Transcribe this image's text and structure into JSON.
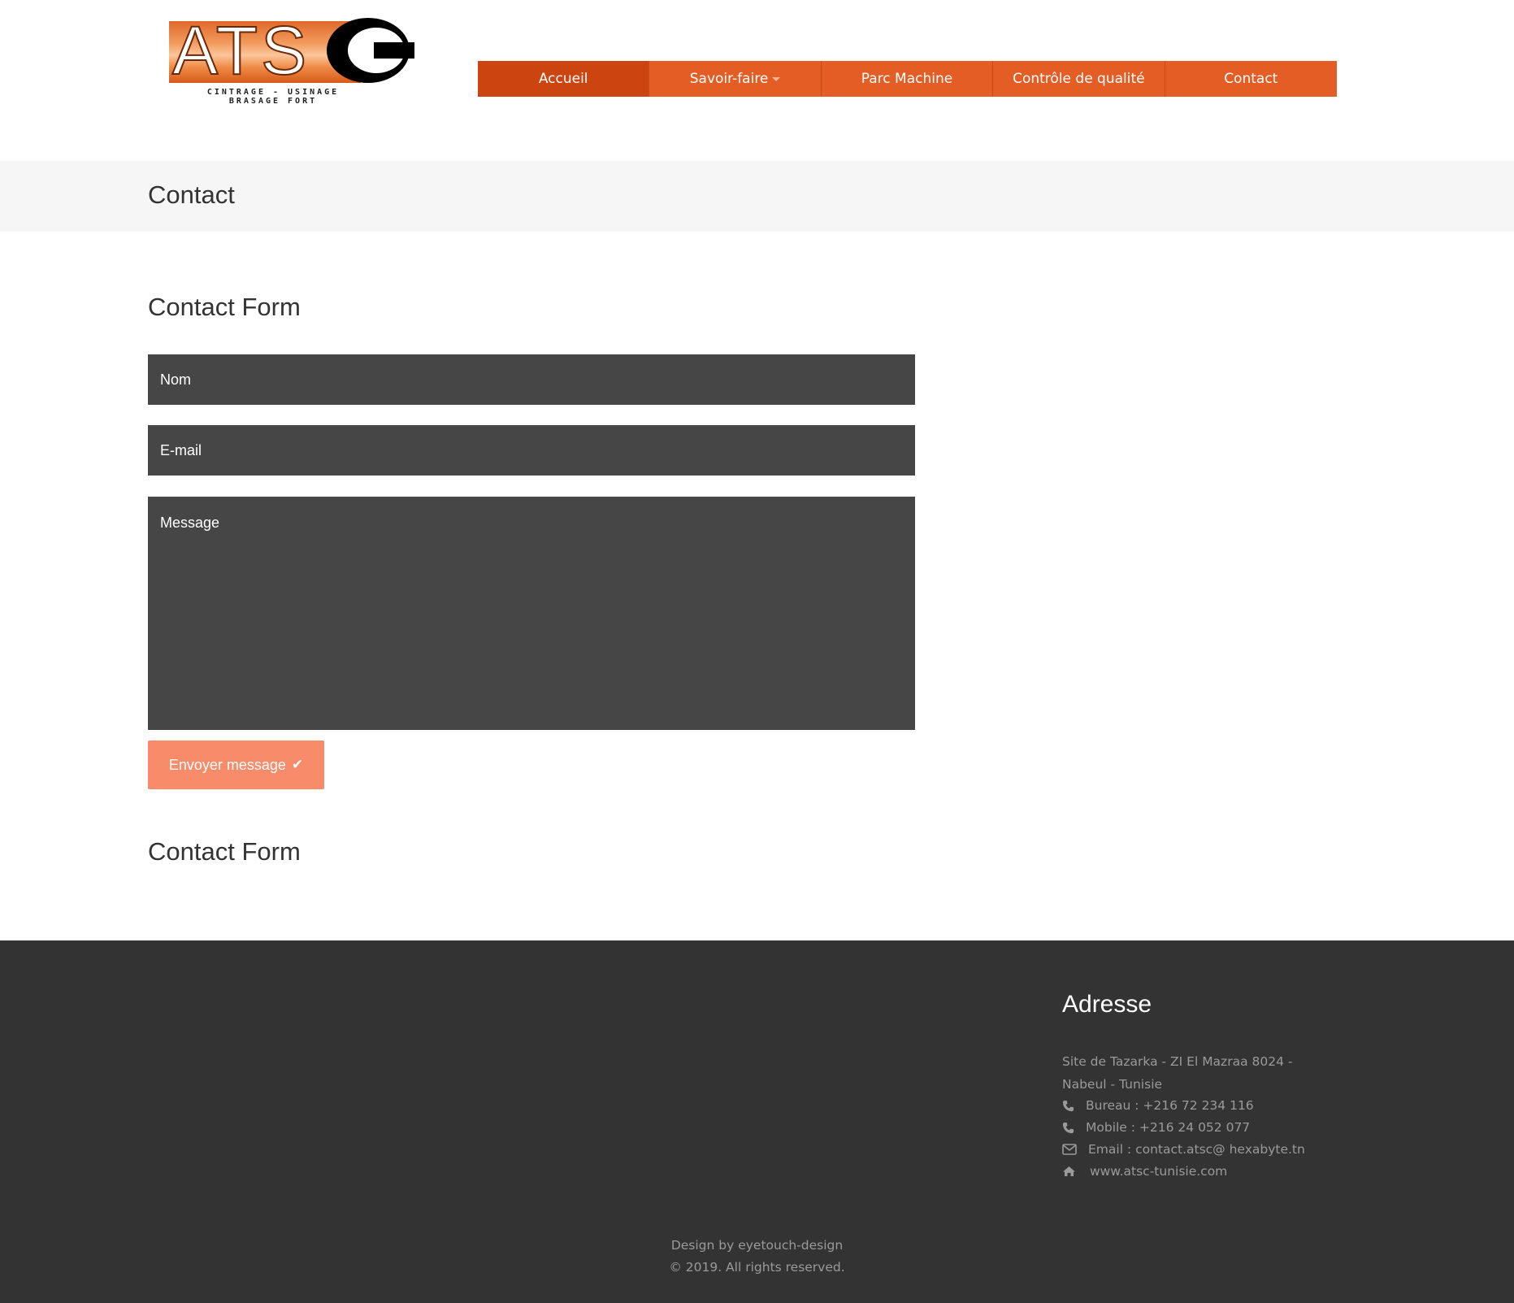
{
  "brand": {
    "logo_letters": "ATS",
    "tagline_line1": "CINTRAGE - USINAGE",
    "tagline_line2": "BRASAGE FORT"
  },
  "nav": {
    "items": [
      {
        "label": "Accueil",
        "active": true
      },
      {
        "label": "Savoir-faire",
        "has_dropdown": true
      },
      {
        "label": "Parc Machine"
      },
      {
        "label": "Contrôle de qualité"
      },
      {
        "label": "Contact"
      }
    ]
  },
  "page": {
    "title": "Contact"
  },
  "form": {
    "title": "Contact Form",
    "name_placeholder": "Nom",
    "email_placeholder": "E-mail",
    "message_placeholder": "Message",
    "submit_label": "Envoyer message",
    "second_title": "Contact Form"
  },
  "footer": {
    "address_heading": "Adresse",
    "address": "Site de Tazarka - ZI El Mazraa 8024 - Nabeul - Tunisie",
    "phone_office": "Bureau : +216 72 234 116",
    "phone_mobile": "Mobile : +216 24 052 077",
    "email": "Email : contact.atsc@ hexabyte.tn",
    "website": "www.atsc-tunisie.com",
    "design_credit": "Design by eyetouch-design",
    "copyright": "© 2019. All rights reserved."
  },
  "colors": {
    "nav_bg": "#e35d25",
    "nav_active": "#cc4511",
    "field_bg": "#464646",
    "button_bg": "#f88c6a",
    "footer_bg": "#333333"
  }
}
